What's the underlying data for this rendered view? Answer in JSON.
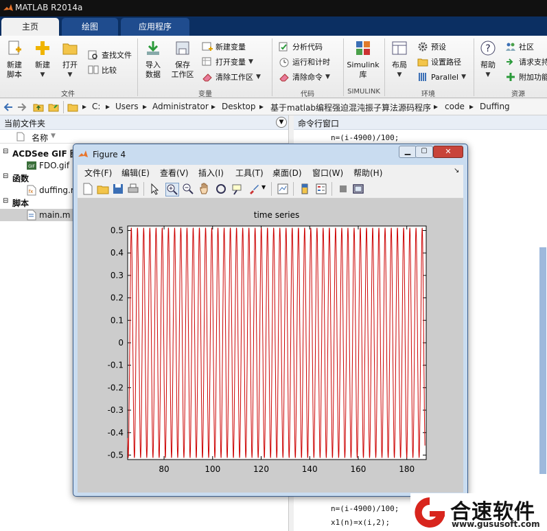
{
  "app": {
    "title": "MATLAB R2014a"
  },
  "tabs": [
    {
      "label": "主页",
      "active": true
    },
    {
      "label": "绘图",
      "active": false
    },
    {
      "label": "应用程序",
      "active": false
    }
  ],
  "ribbon": {
    "file": {
      "group_label": "文件",
      "new_script": [
        "新建",
        "脚本"
      ],
      "new": "新建",
      "open": "打开",
      "find_files": "查找文件",
      "compare": "比较"
    },
    "variable": {
      "group_label": "变量",
      "import": [
        "导入",
        "数据"
      ],
      "save_workspace": [
        "保存",
        "工作区"
      ],
      "new_variable": "新建变量",
      "open_variable": "打开变量",
      "clear_workspace": "清除工作区"
    },
    "code": {
      "group_label": "代码",
      "analyze": "分析代码",
      "run_time": "运行和计时",
      "clear_commands": "清除命令"
    },
    "simulink": {
      "group_label": "SIMULINK",
      "label": [
        "Simulink",
        "库"
      ]
    },
    "environment": {
      "group_label": "环境",
      "layout": "布局",
      "preferences": "预设",
      "set_path": "设置路径",
      "parallel": "Parallel"
    },
    "resources": {
      "group_label": "资源",
      "help": "帮助",
      "community": "社区",
      "request_support": "请求支持",
      "addons": "附加功能"
    }
  },
  "address": [
    "C:",
    "Users",
    "Administrator",
    "Desktop",
    "基于matlab编程强迫混沌振子算法源码程序",
    "code",
    "Duffing"
  ],
  "current_folder": {
    "title": "当前文件夹",
    "column_name": "名称",
    "groups": [
      {
        "label": "ACDSee GIF 图",
        "items": [
          "FDO.gif"
        ]
      },
      {
        "label": "函数",
        "items": [
          "duffing.m"
        ]
      },
      {
        "label": "脚本",
        "items": [
          "main.m"
        ]
      }
    ]
  },
  "command_window": {
    "title": "命令行窗口",
    "lines_top": [
      "n=(i-4900)/100;"
    ],
    "lines_bottom": [
      "n=(i-4900)/100;",
      "x1(n)=x(i,2);"
    ]
  },
  "figure": {
    "title": "Figure 4",
    "menus": [
      "文件(F)",
      "编辑(E)",
      "查看(V)",
      "插入(I)",
      "工具(T)",
      "桌面(D)",
      "窗口(W)",
      "帮助(H)"
    ]
  },
  "watermark": {
    "brand": "合速软件",
    "url": "www.gususoft.com"
  },
  "colors": {
    "accent": "#0b2f62",
    "series": "#cc0000"
  },
  "chart_data": {
    "type": "line",
    "title": "time series",
    "xlim": [
      65,
      188
    ],
    "ylim": [
      -0.52,
      0.52
    ],
    "xticks": [
      80,
      100,
      120,
      140,
      160,
      180
    ],
    "yticks": [
      0.5,
      0.4,
      0.3,
      0.2,
      0.1,
      0,
      -0.1,
      -0.2,
      -0.3,
      -0.4,
      -0.5
    ],
    "series": [
      {
        "color": "#cc0000",
        "period": 2.55,
        "x_start": 65,
        "x_end": 187.5,
        "amplitude": 0.5,
        "first_peak_x": 66.5
      }
    ],
    "grid": false
  }
}
